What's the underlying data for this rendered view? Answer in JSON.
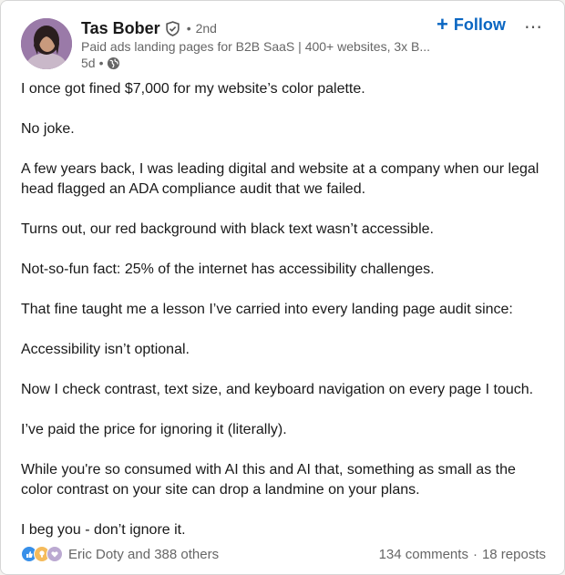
{
  "author": {
    "name": "Tas Bober",
    "degree": "2nd",
    "headline": "Paid ads landing pages for B2B SaaS | 400+ websites, 3x B...",
    "time": "5d",
    "separator": "•"
  },
  "actions": {
    "follow_label": "Follow",
    "more_label": "⋯"
  },
  "post": {
    "paragraphs": [
      "I once got fined $7,000 for my website’s color palette.",
      "No joke.",
      "A few years back, I was leading digital and website at a company when our legal head flagged an ADA compliance audit that we failed.",
      "Turns out, our red background with black text wasn’t accessible.",
      "Not-so-fun fact: 25% of the internet has accessibility challenges.",
      "That fine taught me a lesson I’ve carried into every landing page audit since:",
      "Accessibility isn’t optional.",
      "Now I check contrast, text size, and keyboard navigation on every page I touch.",
      "I’ve paid the price for ignoring it (literally).",
      "While you're so consumed with AI this and AI that, something as small as the color contrast on your site can drop a landmine on your plans.",
      "I beg you - don’t ignore it."
    ]
  },
  "social": {
    "reactors": "Eric Doty and 388 others",
    "comments": "134 comments",
    "separator": "·",
    "reposts": "18 reposts"
  },
  "colors": {
    "accent": "#0a66c2",
    "text": "#191919",
    "muted": "#666666"
  }
}
